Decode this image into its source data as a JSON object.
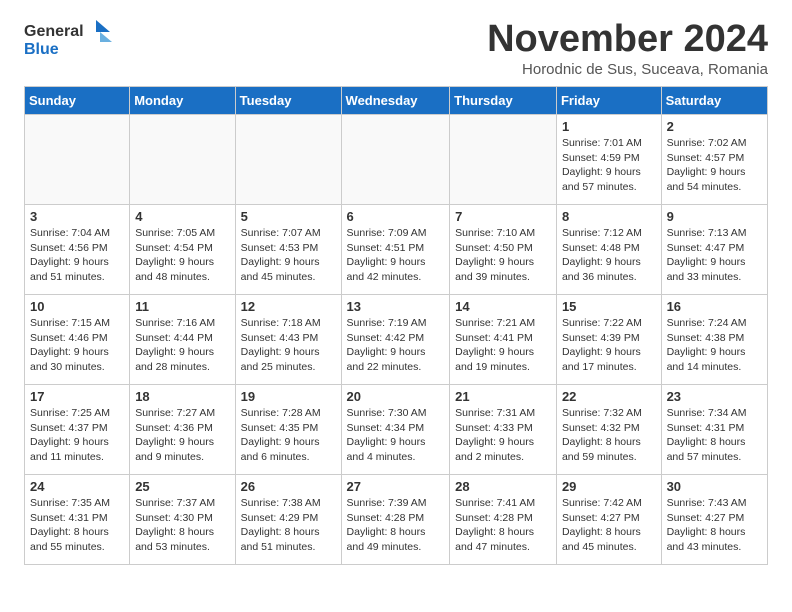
{
  "header": {
    "logo_line1": "General",
    "logo_line2": "Blue",
    "month": "November 2024",
    "location": "Horodnic de Sus, Suceava, Romania"
  },
  "days_of_week": [
    "Sunday",
    "Monday",
    "Tuesday",
    "Wednesday",
    "Thursday",
    "Friday",
    "Saturday"
  ],
  "weeks": [
    [
      {
        "num": "",
        "detail": ""
      },
      {
        "num": "",
        "detail": ""
      },
      {
        "num": "",
        "detail": ""
      },
      {
        "num": "",
        "detail": ""
      },
      {
        "num": "",
        "detail": ""
      },
      {
        "num": "1",
        "detail": "Sunrise: 7:01 AM\nSunset: 4:59 PM\nDaylight: 9 hours and 57 minutes."
      },
      {
        "num": "2",
        "detail": "Sunrise: 7:02 AM\nSunset: 4:57 PM\nDaylight: 9 hours and 54 minutes."
      }
    ],
    [
      {
        "num": "3",
        "detail": "Sunrise: 7:04 AM\nSunset: 4:56 PM\nDaylight: 9 hours and 51 minutes."
      },
      {
        "num": "4",
        "detail": "Sunrise: 7:05 AM\nSunset: 4:54 PM\nDaylight: 9 hours and 48 minutes."
      },
      {
        "num": "5",
        "detail": "Sunrise: 7:07 AM\nSunset: 4:53 PM\nDaylight: 9 hours and 45 minutes."
      },
      {
        "num": "6",
        "detail": "Sunrise: 7:09 AM\nSunset: 4:51 PM\nDaylight: 9 hours and 42 minutes."
      },
      {
        "num": "7",
        "detail": "Sunrise: 7:10 AM\nSunset: 4:50 PM\nDaylight: 9 hours and 39 minutes."
      },
      {
        "num": "8",
        "detail": "Sunrise: 7:12 AM\nSunset: 4:48 PM\nDaylight: 9 hours and 36 minutes."
      },
      {
        "num": "9",
        "detail": "Sunrise: 7:13 AM\nSunset: 4:47 PM\nDaylight: 9 hours and 33 minutes."
      }
    ],
    [
      {
        "num": "10",
        "detail": "Sunrise: 7:15 AM\nSunset: 4:46 PM\nDaylight: 9 hours and 30 minutes."
      },
      {
        "num": "11",
        "detail": "Sunrise: 7:16 AM\nSunset: 4:44 PM\nDaylight: 9 hours and 28 minutes."
      },
      {
        "num": "12",
        "detail": "Sunrise: 7:18 AM\nSunset: 4:43 PM\nDaylight: 9 hours and 25 minutes."
      },
      {
        "num": "13",
        "detail": "Sunrise: 7:19 AM\nSunset: 4:42 PM\nDaylight: 9 hours and 22 minutes."
      },
      {
        "num": "14",
        "detail": "Sunrise: 7:21 AM\nSunset: 4:41 PM\nDaylight: 9 hours and 19 minutes."
      },
      {
        "num": "15",
        "detail": "Sunrise: 7:22 AM\nSunset: 4:39 PM\nDaylight: 9 hours and 17 minutes."
      },
      {
        "num": "16",
        "detail": "Sunrise: 7:24 AM\nSunset: 4:38 PM\nDaylight: 9 hours and 14 minutes."
      }
    ],
    [
      {
        "num": "17",
        "detail": "Sunrise: 7:25 AM\nSunset: 4:37 PM\nDaylight: 9 hours and 11 minutes."
      },
      {
        "num": "18",
        "detail": "Sunrise: 7:27 AM\nSunset: 4:36 PM\nDaylight: 9 hours and 9 minutes."
      },
      {
        "num": "19",
        "detail": "Sunrise: 7:28 AM\nSunset: 4:35 PM\nDaylight: 9 hours and 6 minutes."
      },
      {
        "num": "20",
        "detail": "Sunrise: 7:30 AM\nSunset: 4:34 PM\nDaylight: 9 hours and 4 minutes."
      },
      {
        "num": "21",
        "detail": "Sunrise: 7:31 AM\nSunset: 4:33 PM\nDaylight: 9 hours and 2 minutes."
      },
      {
        "num": "22",
        "detail": "Sunrise: 7:32 AM\nSunset: 4:32 PM\nDaylight: 8 hours and 59 minutes."
      },
      {
        "num": "23",
        "detail": "Sunrise: 7:34 AM\nSunset: 4:31 PM\nDaylight: 8 hours and 57 minutes."
      }
    ],
    [
      {
        "num": "24",
        "detail": "Sunrise: 7:35 AM\nSunset: 4:31 PM\nDaylight: 8 hours and 55 minutes."
      },
      {
        "num": "25",
        "detail": "Sunrise: 7:37 AM\nSunset: 4:30 PM\nDaylight: 8 hours and 53 minutes."
      },
      {
        "num": "26",
        "detail": "Sunrise: 7:38 AM\nSunset: 4:29 PM\nDaylight: 8 hours and 51 minutes."
      },
      {
        "num": "27",
        "detail": "Sunrise: 7:39 AM\nSunset: 4:28 PM\nDaylight: 8 hours and 49 minutes."
      },
      {
        "num": "28",
        "detail": "Sunrise: 7:41 AM\nSunset: 4:28 PM\nDaylight: 8 hours and 47 minutes."
      },
      {
        "num": "29",
        "detail": "Sunrise: 7:42 AM\nSunset: 4:27 PM\nDaylight: 8 hours and 45 minutes."
      },
      {
        "num": "30",
        "detail": "Sunrise: 7:43 AM\nSunset: 4:27 PM\nDaylight: 8 hours and 43 minutes."
      }
    ]
  ]
}
